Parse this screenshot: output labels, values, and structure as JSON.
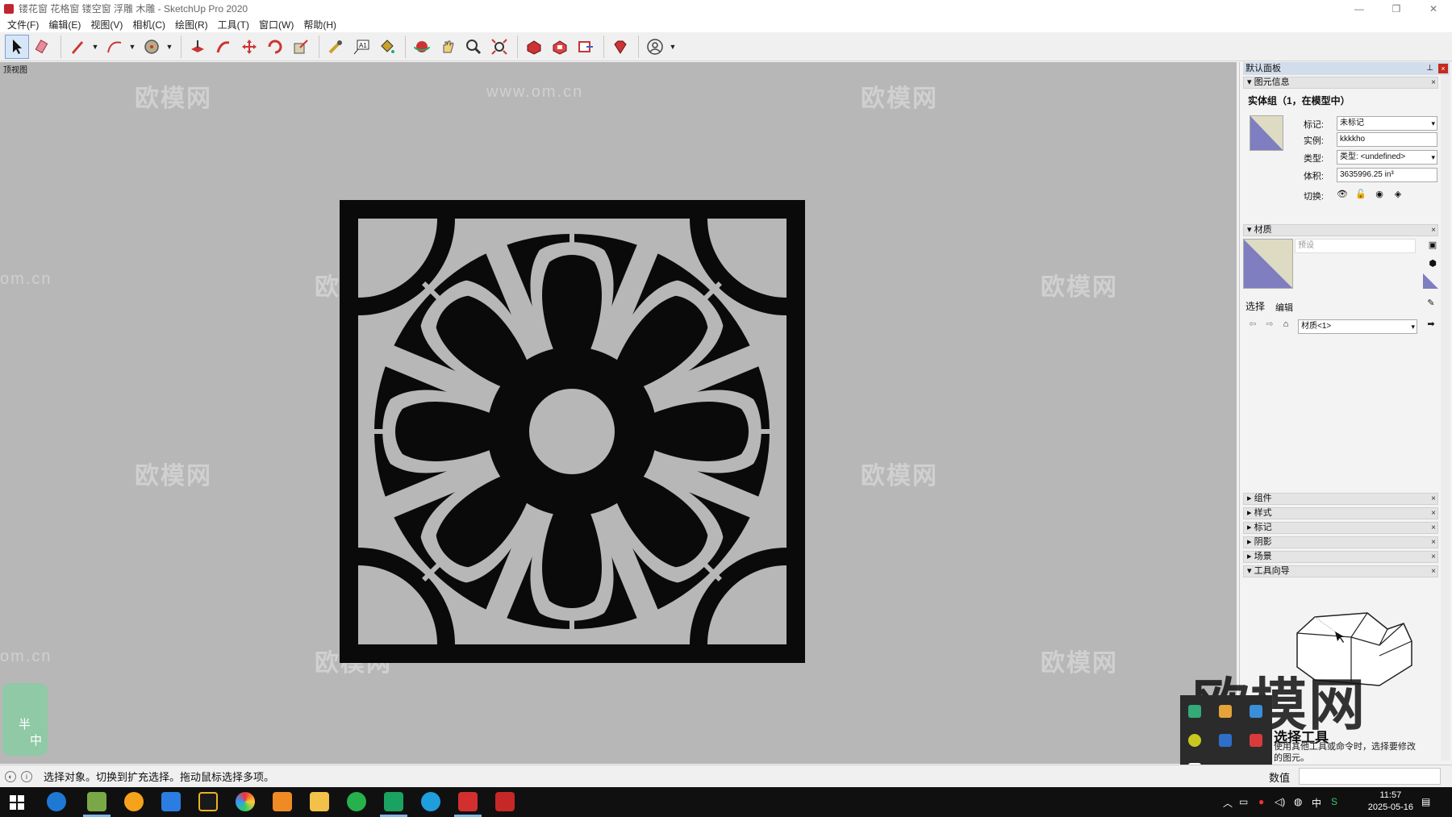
{
  "window": {
    "title": "镂花窗 花格窗 镂空窗 浮雕 木雕 - SketchUp Pro 2020",
    "minimize": "—",
    "restore": "❐",
    "close": "✕"
  },
  "menu": [
    "文件(F)",
    "编辑(E)",
    "视图(V)",
    "相机(C)",
    "绘图(R)",
    "工具(T)",
    "窗口(W)",
    "帮助(H)"
  ],
  "viewport": {
    "scene_tab": "顶视图",
    "watermarks": [
      "欧模网",
      "www.om.cn",
      "om.cn"
    ],
    "ime_labels": [
      "半",
      "中"
    ]
  },
  "statusbar": {
    "message": "选择对象。切换到扩充选择。拖动鼠标选择多项。",
    "measure_label": "数值"
  },
  "tray": {
    "title": "默认面板",
    "pin": "⊥",
    "close": "×",
    "entity_info": {
      "header": "图元信息",
      "entity_title": "实体组（1，在模型中）",
      "labels": {
        "tag": "标记:",
        "instance": "实例:",
        "type": "类型:",
        "volume": "体积:",
        "toggle": "切换:"
      },
      "values": {
        "tag": "未标记",
        "instance": "kkkkho",
        "type": "类型: <undefined>",
        "volume": "3635996.25 in³"
      }
    },
    "materials": {
      "header": "材质",
      "name_placeholder": "预设",
      "tabs": [
        "选择",
        "编辑"
      ],
      "selected": "材质<1>"
    },
    "sections": [
      "组件",
      "样式",
      "标记",
      "阴影",
      "场景",
      "工具向导"
    ],
    "instructor": {
      "watermark": "欧模网",
      "title": "选择工具",
      "desc": "使用其他工具或命令时，选择要修改的图元。"
    }
  },
  "taskbar": {
    "time": "11:57",
    "date": "2025-05-16",
    "ime": "中"
  },
  "colors": {
    "viewport_bg": "#b7b7b7",
    "panel_fill": "#0a0a0a",
    "selection_blue": "#7e7ec0"
  }
}
